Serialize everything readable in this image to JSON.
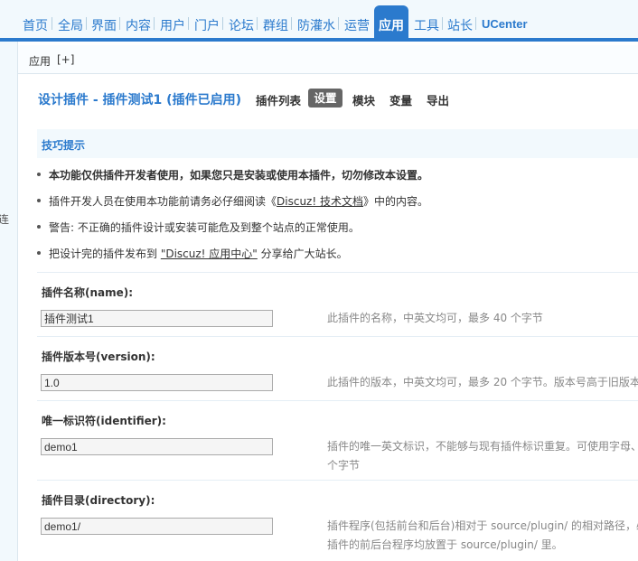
{
  "topnav": {
    "items": [
      "首页",
      "全局",
      "界面",
      "内容",
      "用户",
      "门户",
      "论坛",
      "群组",
      "防灌水",
      "运营",
      "应用",
      "工具",
      "站长",
      "UCenter"
    ],
    "active_label": "应用"
  },
  "leftbar": {
    "cut_text": "连"
  },
  "breadcrumb": {
    "label": "应用",
    "toggle": "[+]"
  },
  "page": {
    "title": "设计插件 - 插件测试1 (插件已启用)",
    "tabs": [
      "插件列表",
      "设置",
      "模块",
      "变量",
      "导出"
    ],
    "active_tab": "设置"
  },
  "tips": {
    "header": "技巧提示",
    "items": [
      "本功能仅供插件开发者使用，如果您只是安装或使用本插件，切勿修改本设置。",
      "插件开发人员在使用本功能前请务必仔细阅读《",
      "Discuz! 技术文档",
      "》中的内容。",
      "警告: 不正确的插件设计或安装可能危及到整个站点的正常使用。",
      "把设计完的插件发布到 ",
      "\"Discuz! 应用中心\"",
      " 分享给广大站长。"
    ]
  },
  "form": {
    "fields": [
      {
        "label": "插件名称(name):",
        "value": "插件测试1",
        "desc": "此插件的名称，中英文均可，最多 40 个字节"
      },
      {
        "label": "插件版本号(version):",
        "value": "1.0",
        "desc": "此插件的版本，中英文均可，最多 20 个字节。版本号高于旧版本"
      },
      {
        "label": "唯一标识符(identifier):",
        "value": "demo1",
        "desc": "插件的唯一英文标识，不能够与现有插件标识重复。可使用字母、",
        "desc2": "个字节"
      },
      {
        "label": "插件目录(directory):",
        "value": "demo1/",
        "desc": "插件程序(包括前台和后台)相对于 source/plugin/ 的相对路径，必须",
        "desc2": "插件的前后台程序均放置于 source/plugin/ 里。"
      }
    ]
  },
  "colors": {
    "accent": "#2b7acd",
    "active_tab_bg": "#666666"
  }
}
